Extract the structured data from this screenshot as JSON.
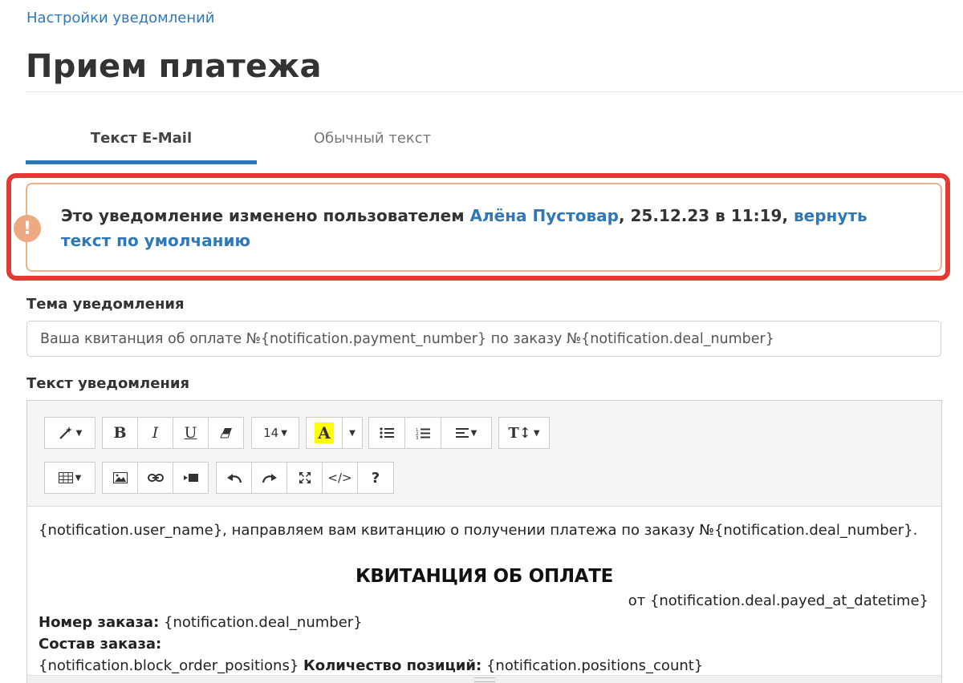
{
  "breadcrumb": "Настройки уведомлений",
  "title": "Прием платежа",
  "tabs": [
    {
      "label": "Текст E-Mail",
      "active": true
    },
    {
      "label": "Обычный текст",
      "active": false
    }
  ],
  "alert": {
    "text_before": "Это уведомление изменено пользователем ",
    "user": "Алёна Пустовар",
    "text_after": ", 25.12.23 в 11:19, ",
    "reset_link": "вернуть текст по умолчанию",
    "icon": "!"
  },
  "subject": {
    "label": "Тема уведомления",
    "value": "Ваша квитанция об оплате №{notification.payment_number} по заказу №{notification.deal_number}"
  },
  "body": {
    "label": "Текст уведомления",
    "font_size": "14",
    "highlight_letter": "A",
    "lines": {
      "greeting": "{notification.user_name}, направляем вам квитанцию о получении платежа по заказу №{notification.deal_number}.",
      "receipt_title": "КВИТАНЦИЯ ОБ ОПЛАТЕ",
      "date_line": "от {notification.deal.payed_at_datetime}",
      "order_number_label": "Номер заказа:",
      "order_number_value": " {notification.deal_number}",
      "order_contents_label": "Состав заказа:",
      "positions_value": "{notification.block_order_positions} ",
      "positions_count_label": "Количество позиций:",
      "positions_count_value": " {notification.positions_count}"
    }
  },
  "colors": {
    "link": "#2f78b7",
    "alert_border": "#eeb08c",
    "alert_icon": "#eea983",
    "highlight_frame": "#e03c33",
    "text_highlight": "#ffff00"
  }
}
